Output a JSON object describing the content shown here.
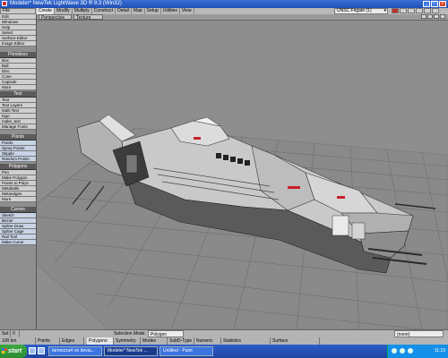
{
  "window": {
    "title": "Modeler* NewTek LightWave 3D ® 9.3 (Win32)",
    "min": "_",
    "max": "□",
    "close": "×"
  },
  "menubar": {
    "file": "File",
    "tabs": [
      "Create",
      "Modify",
      "Multiply",
      "Construct",
      "Detail",
      "Map",
      "Setup",
      "Utilities",
      "View"
    ],
    "figure_select": "UNSC Frigate (1)",
    "figure_arrow": "▾"
  },
  "viewbar": {
    "view_mode": "Perspective",
    "render_mode": "Texture"
  },
  "sidebar": {
    "menu": [
      {
        "label": "Edit"
      },
      {
        "label": "Windows"
      },
      {
        "label": "Help"
      },
      {
        "label": "Select"
      },
      {
        "label": "Surface Editor"
      },
      {
        "label": "Image Editor"
      }
    ],
    "sections": [
      {
        "title": "Primitives",
        "items": [
          "Box",
          "Ball",
          "Disc",
          "Cone",
          "Capsule",
          "More"
        ]
      },
      {
        "title": "Text",
        "items": [
          "Text",
          "Text Layers",
          "Multi Text",
          "logo",
          "make_text",
          "Manage Fonts"
        ]
      },
      {
        "title": "Points",
        "items": [
          "Points",
          "Spray Points",
          "Stipple",
          "Random Points"
        ]
      },
      {
        "title": "Polygons",
        "items": [
          "Pen",
          "Make Polygon",
          "Points to Polys",
          "Metaballs",
          "Metaedges",
          "More"
        ]
      },
      {
        "title": "Curves",
        "items": [
          "Sketch",
          "Bezier",
          "Spline Draw",
          "Spline Cage",
          "Rail Tool",
          "Make Curve"
        ]
      }
    ]
  },
  "statusbar": {
    "sel_label": "Sel:",
    "sel_value": "0",
    "grid": "100 km",
    "selection_mode_label": "Selection Mode:",
    "selection_mode_value": "Polygon",
    "modes": [
      "Points",
      "Edges",
      "Polygons",
      "Symmetry",
      "Modes",
      "SubD-Type",
      "Numeric",
      "Statistics",
      "Surface"
    ],
    "layer_value": "(none)"
  },
  "taskbar": {
    "start": "start",
    "tasks": [
      "farmezza4 on devia...",
      "Modeler* NewTek ...",
      "Untitled - Paint"
    ],
    "clock": "11:19"
  },
  "colors": {
    "viewport_bg": "#8e8e8e",
    "grid_line": "#6e6e6e",
    "model_light": "#d4d4d4",
    "model_dark": "#3a3a3a",
    "accent_red": "#c8202a"
  }
}
